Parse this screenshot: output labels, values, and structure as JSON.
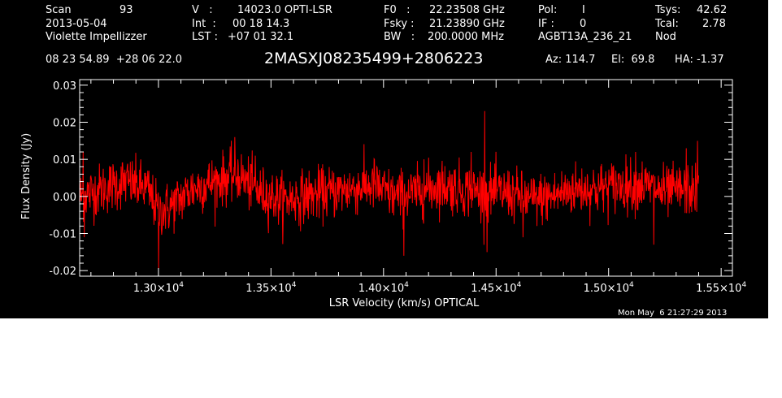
{
  "header": {
    "scan_label": "Scan",
    "scan_value": "93",
    "date": "2013-05-04",
    "observer": "Violette Impellizzer",
    "v_label": "V   :",
    "v_value": "14023.0 OPTI-LSR",
    "int_label": "Int  :",
    "int_value": "00 18 14.3",
    "lst_label": "LST :",
    "lst_value": "+07 01 32.1",
    "f0_label": "F0   :",
    "f0_value": "22.23508 GHz",
    "fsky_label": "Fsky :",
    "fsky_value": "21.23890 GHz",
    "bw_label": "BW   :",
    "bw_value": "200.0000 MHz",
    "pol_label": "Pol:",
    "pol_value": "I",
    "if_label": "IF :",
    "if_value": "0",
    "project": "AGBT13A_236_21",
    "tsys_label": "Tsys:",
    "tsys_value": "42.62",
    "tcal_label": "Tcal:",
    "tcal_value": "2.78",
    "procedure": "Nod",
    "coords": "08 23 54.89  +28 06 22.0",
    "source": "2MASXJ08235499+2806223",
    "az": "Az: 114.7",
    "el": "El:  69.8",
    "ha": "HA: -1.37",
    "timestamp": "Mon May  6 21:27:29 2013"
  },
  "colors": {
    "background": "#000000",
    "foreground": "#ffffff",
    "series": "#ff0000"
  },
  "chart_data": {
    "type": "line",
    "xlabel": "LSR Velocity (km/s) OPTICAL",
    "ylabel": "Flux Density (Jy)",
    "xlim": [
      12650,
      15550
    ],
    "ylim": [
      -0.0215,
      0.0315
    ],
    "x_ticks": [
      {
        "value": 13000,
        "mantissa": "1.30",
        "exp": "4"
      },
      {
        "value": 13500,
        "mantissa": "1.35",
        "exp": "4"
      },
      {
        "value": 14000,
        "mantissa": "1.40",
        "exp": "4"
      },
      {
        "value": 14500,
        "mantissa": "1.45",
        "exp": "4"
      },
      {
        "value": 15000,
        "mantissa": "1.50",
        "exp": "4"
      },
      {
        "value": 15500,
        "mantissa": "1.55",
        "exp": "4"
      }
    ],
    "y_ticks": [
      {
        "value": 0.03,
        "label": "0.03"
      },
      {
        "value": 0.02,
        "label": "0.02"
      },
      {
        "value": 0.01,
        "label": "0.01"
      },
      {
        "value": 0.0,
        "label": "0.00"
      },
      {
        "value": -0.01,
        "label": "-0.01"
      },
      {
        "value": -0.02,
        "label": "-0.02"
      }
    ],
    "grid": false,
    "series": [
      {
        "color": "#ff0000",
        "x_start": 12650,
        "x_end": 15400,
        "baseline": [
          [
            12650,
            0.0
          ],
          [
            12750,
            0.002
          ],
          [
            12850,
            0.004
          ],
          [
            12950,
            0.002
          ],
          [
            13000,
            -0.004
          ],
          [
            13050,
            -0.003
          ],
          [
            13150,
            0.002
          ],
          [
            13250,
            0.004
          ],
          [
            13350,
            0.006
          ],
          [
            13450,
            0.001
          ],
          [
            13550,
            -0.001
          ],
          [
            13650,
            0.0
          ],
          [
            13750,
            0.001
          ],
          [
            13850,
            0.002
          ],
          [
            13950,
            0.003
          ],
          [
            14050,
            0.0
          ],
          [
            14150,
            0.001
          ],
          [
            14250,
            0.003
          ],
          [
            14350,
            0.002
          ],
          [
            14450,
            0.001
          ],
          [
            14550,
            0.001
          ],
          [
            14650,
            -0.001
          ],
          [
            14750,
            0.0
          ],
          [
            14850,
            0.002
          ],
          [
            14950,
            0.002
          ],
          [
            15050,
            0.003
          ],
          [
            15150,
            0.003
          ],
          [
            15250,
            0.001
          ],
          [
            15350,
            0.002
          ],
          [
            15400,
            0.001
          ]
        ],
        "noise_rms": 0.0035,
        "spikes": [
          [
            12665,
            0.012
          ],
          [
            12670,
            -0.011
          ],
          [
            13000,
            -0.0195
          ],
          [
            13340,
            0.016
          ],
          [
            13430,
            0.011
          ],
          [
            13960,
            0.01
          ],
          [
            14090,
            -0.016
          ],
          [
            14180,
            0.01
          ],
          [
            14390,
            0.012
          ],
          [
            14450,
            0.023
          ],
          [
            14460,
            -0.015
          ],
          [
            14620,
            -0.011
          ],
          [
            15120,
            0.012
          ],
          [
            15200,
            -0.013
          ],
          [
            15345,
            0.013
          ],
          [
            15395,
            0.015
          ]
        ]
      }
    ]
  }
}
